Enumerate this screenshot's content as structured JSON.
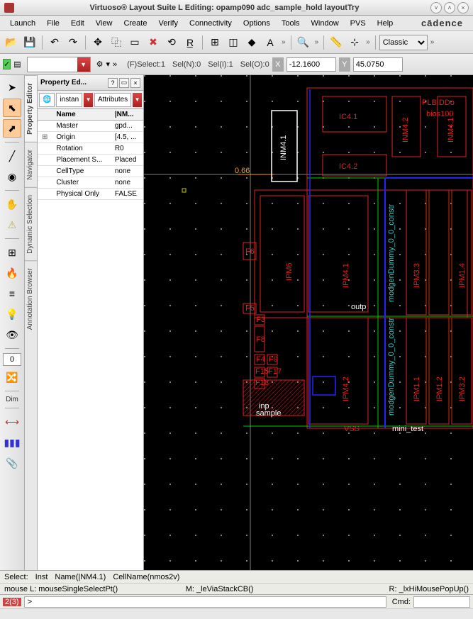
{
  "titlebar": {
    "title": "Virtuoso® Layout Suite L Editing: opamp090 adc_sample_hold layoutTry"
  },
  "menu": {
    "items": [
      "Launch",
      "File",
      "Edit",
      "View",
      "Create",
      "Verify",
      "Connectivity",
      "Options",
      "Tools",
      "Window",
      "PVS",
      "Help"
    ],
    "brand": "cādence"
  },
  "toolbar": {
    "style_select": "Classic"
  },
  "toolbar2": {
    "fselect": "(F)Select:1",
    "seln": "Sel(N):0",
    "seli": "Sel(I):1",
    "selo": "Sel(O):0",
    "x": "-12.1600",
    "y": "45.0750"
  },
  "vtoolbar": {
    "input_val": "0",
    "dim_label": "Dim"
  },
  "vtabs": {
    "items": [
      "Property Editor",
      "Navigator",
      "Dynamic Selection",
      "Annotation Browser"
    ]
  },
  "propeditor": {
    "title": "Property Ed...",
    "tab_instance": "instan",
    "tab_attributes": "Attributes",
    "headers": {
      "name": "Name",
      "value": "|NM..."
    },
    "rows": [
      {
        "name": "Master",
        "value": "gpd..."
      },
      {
        "name": "Origin",
        "value": "[4.5, ...",
        "expand": true
      },
      {
        "name": "Rotation",
        "value": "R0"
      },
      {
        "name": "Placement S...",
        "value": "Placed"
      },
      {
        "name": "CellType",
        "value": "none"
      },
      {
        "name": "Cluster",
        "value": "none"
      },
      {
        "name": "Physical Only",
        "value": "FALSE"
      }
    ]
  },
  "canvas": {
    "ruler": "0.66",
    "labels": [
      "INM4.1",
      "IC4.1",
      "INM4.2",
      "PLBIDDo",
      "bios100",
      "IC4.2",
      "IPM6",
      "IPM4.1",
      "INM4.1",
      "IPM3.3",
      "IPM1.4",
      "outp",
      "IPM4.2",
      "IPM1.1",
      "IPM1.2",
      "IPM3.2",
      "inp",
      "sample",
      "VSS",
      "mini_test",
      "F6",
      "F5",
      "F3",
      "F8",
      "F4",
      "F9",
      "F15",
      "F17",
      "F18"
    ]
  },
  "statusbar": {
    "select": "Select:",
    "inst": "Inst",
    "name": "Name(|NM4.1)",
    "cellname": "CellName(nmos2v)"
  },
  "mousebar": {
    "l": "mouse L: mouseSingleSelectPt()",
    "m": "M: _leViaStackCB()",
    "r": "R: _lxHiMousePopUp()"
  },
  "cmdbar": {
    "badge": "2(3)",
    "prompt": ">",
    "cmdlabel": "Cmd:"
  }
}
